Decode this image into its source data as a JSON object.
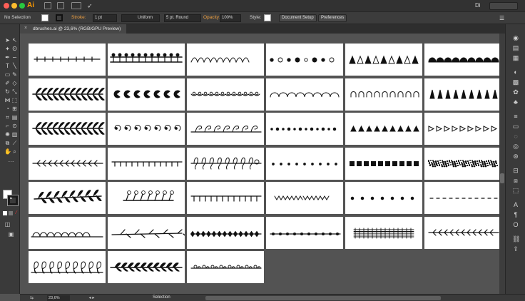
{
  "app": {
    "logo": "Ai",
    "workspace": "Di"
  },
  "control_bar": {
    "selection_label": "No Selection",
    "stroke_label": "Stroke:",
    "stroke_weight": "1 pt",
    "profile": "Uniform",
    "brush": "5 pt. Round",
    "opacity_label": "Opacity:",
    "opacity_value": "100%",
    "style_label": "Style:",
    "document_setup": "Document Setup",
    "preferences": "Preferences"
  },
  "document": {
    "tab_title": "dbrushes.ai @ 23,6% (RGB/GPU Preview)",
    "close_glyph": "×"
  },
  "status": {
    "zoom": "23,6%",
    "tool": "Selection"
  },
  "artboards": [
    {
      "style": "line-ticks"
    },
    {
      "style": "fence-bar"
    },
    {
      "style": "loop-cursive"
    },
    {
      "style": "mixed-dots"
    },
    {
      "style": "triangles-row"
    },
    {
      "style": "half-domes"
    },
    {
      "style": "fern-leaves"
    },
    {
      "style": "pacman-shapes"
    },
    {
      "style": "bead-string"
    },
    {
      "style": "scallop-arcs"
    },
    {
      "style": "small-arches"
    },
    {
      "style": "spikes"
    },
    {
      "style": "fern-leaves"
    },
    {
      "style": "curl-hooks"
    },
    {
      "style": "vine-curls"
    },
    {
      "style": "dots-row"
    },
    {
      "style": "filled-triangles"
    },
    {
      "style": "outline-triangles"
    },
    {
      "style": "arrow-line"
    },
    {
      "style": "comb-line"
    },
    {
      "style": "flourish-loops"
    },
    {
      "style": "sparse-dots"
    },
    {
      "style": "blocks-row"
    },
    {
      "style": "speckle-band"
    },
    {
      "style": "branch-leaves"
    },
    {
      "style": "sprigs-line"
    },
    {
      "style": "comb-line-long"
    },
    {
      "style": "zigzag"
    },
    {
      "style": "spaced-dots"
    },
    {
      "style": "dashes"
    },
    {
      "style": "arcs-line"
    },
    {
      "style": "twig-line"
    },
    {
      "style": "knot-dots"
    },
    {
      "style": "dot-line"
    },
    {
      "style": "music-staff"
    },
    {
      "style": "arrow-line"
    },
    {
      "style": "loops-tall"
    },
    {
      "style": "leaf-garland"
    },
    {
      "style": "bead-curls"
    }
  ]
}
